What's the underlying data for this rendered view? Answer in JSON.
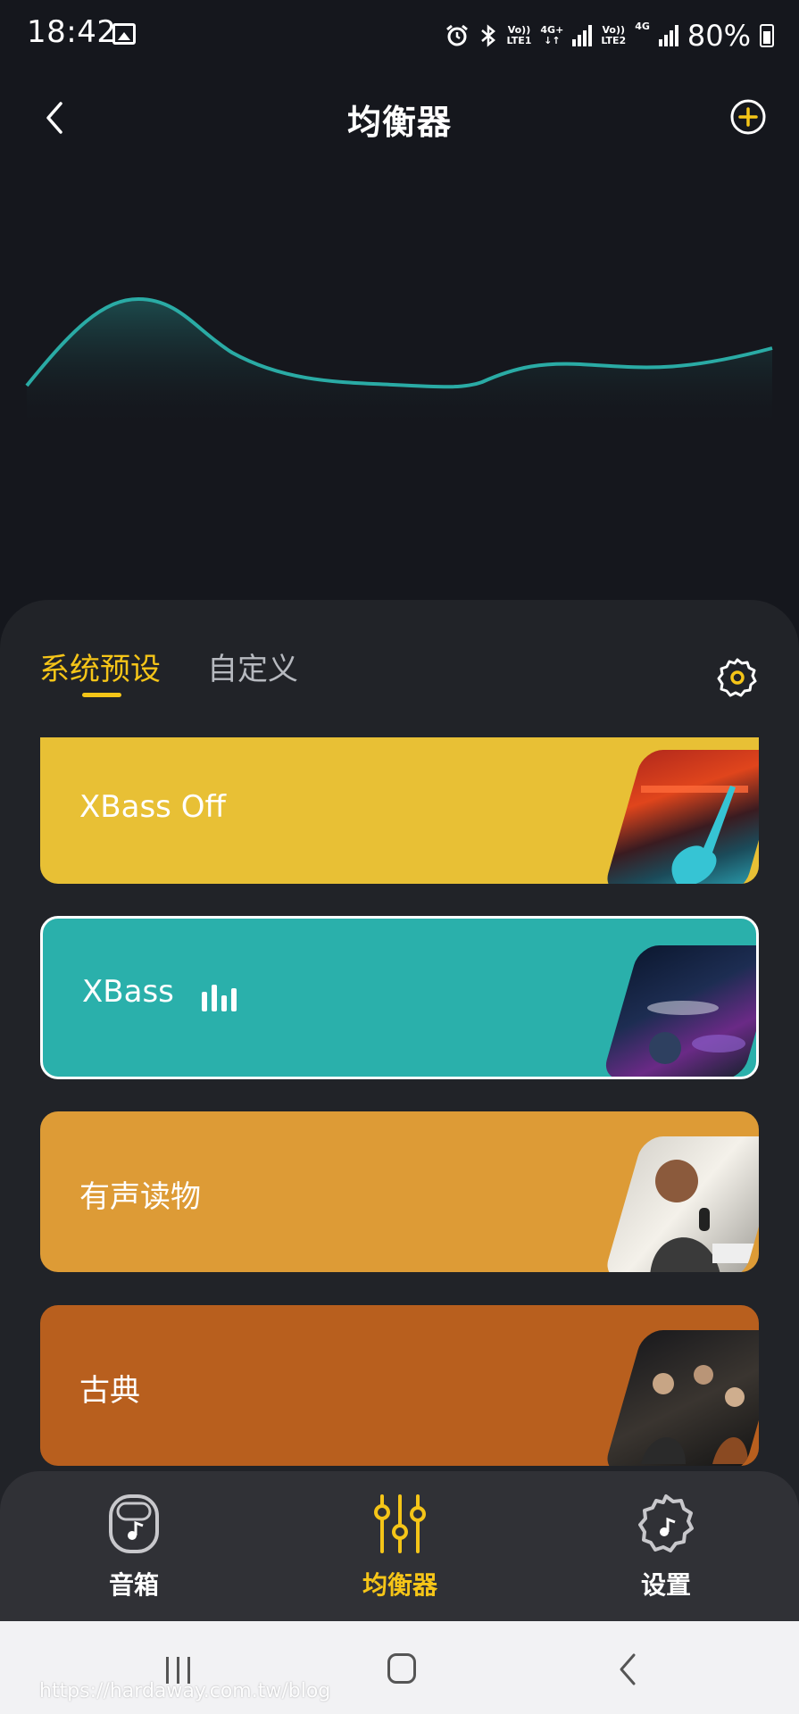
{
  "status_bar": {
    "time": "18:42",
    "sim1": {
      "vo": "Vo))",
      "lte": "LTE1",
      "net": "4G+"
    },
    "sim2": {
      "vo": "Vo))",
      "lte": "LTE2",
      "net": "4G"
    },
    "battery": "80%"
  },
  "header": {
    "title": "均衡器"
  },
  "tabs": {
    "system_preset": "系统预设",
    "custom": "自定义",
    "active": "system_preset"
  },
  "presets": [
    {
      "label": "XBass Off",
      "color": "#e8c035",
      "selected": false,
      "thumb": "guitar"
    },
    {
      "label": "XBass",
      "color": "#2ab0ab",
      "selected": true,
      "playing": true,
      "thumb": "drums"
    },
    {
      "label": "有声读物",
      "color": "#dd9b36",
      "selected": false,
      "thumb": "microphone"
    },
    {
      "label": "古典",
      "color": "#b85f1e",
      "selected": false,
      "thumb": "orchestra"
    }
  ],
  "bottom_nav": {
    "speaker": "音箱",
    "equalizer": "均衡器",
    "settings": "设置",
    "active": "equalizer"
  },
  "accent_color": "#f5c518",
  "curve_color": "#2aaba5",
  "watermark": "https://hardaway.com.tw/blog"
}
